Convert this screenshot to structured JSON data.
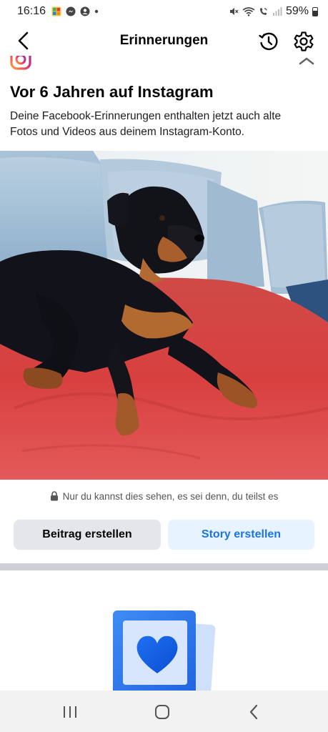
{
  "status_bar": {
    "time": "16:16",
    "battery": "59%",
    "icons": [
      "gallery-icon",
      "messenger-icon",
      "account-icon",
      "dot-icon",
      "mute-icon",
      "wifi-icon",
      "wifi-call-icon",
      "signal-icon",
      "battery-icon"
    ]
  },
  "header": {
    "title": "Erinnerungen",
    "icons": [
      "back-arrow-icon",
      "history-icon",
      "gear-icon"
    ]
  },
  "memory": {
    "source_icon": "instagram-icon",
    "title": "Vor 6 Jahren auf Instagram",
    "description": "Deine Facebook-Erinnerungen enthalten jetzt auch alte Fotos und Videos aus deinem Instagram-Konto.",
    "photo_subject": "rottweiler-on-red-blanket"
  },
  "privacy_note": "Nur du kannst dies sehen, es sei denn, du teilst es",
  "actions": {
    "create_post": "Beitrag erstellen",
    "create_story": "Story erstellen"
  },
  "colors": {
    "primary_blue": "#1b74e4",
    "story_bg": "#e7f3ff",
    "post_bg": "#e4e6eb",
    "divider": "#ced0d4"
  },
  "nav": {
    "icons": [
      "recent-apps-icon",
      "home-icon",
      "back-icon"
    ]
  }
}
